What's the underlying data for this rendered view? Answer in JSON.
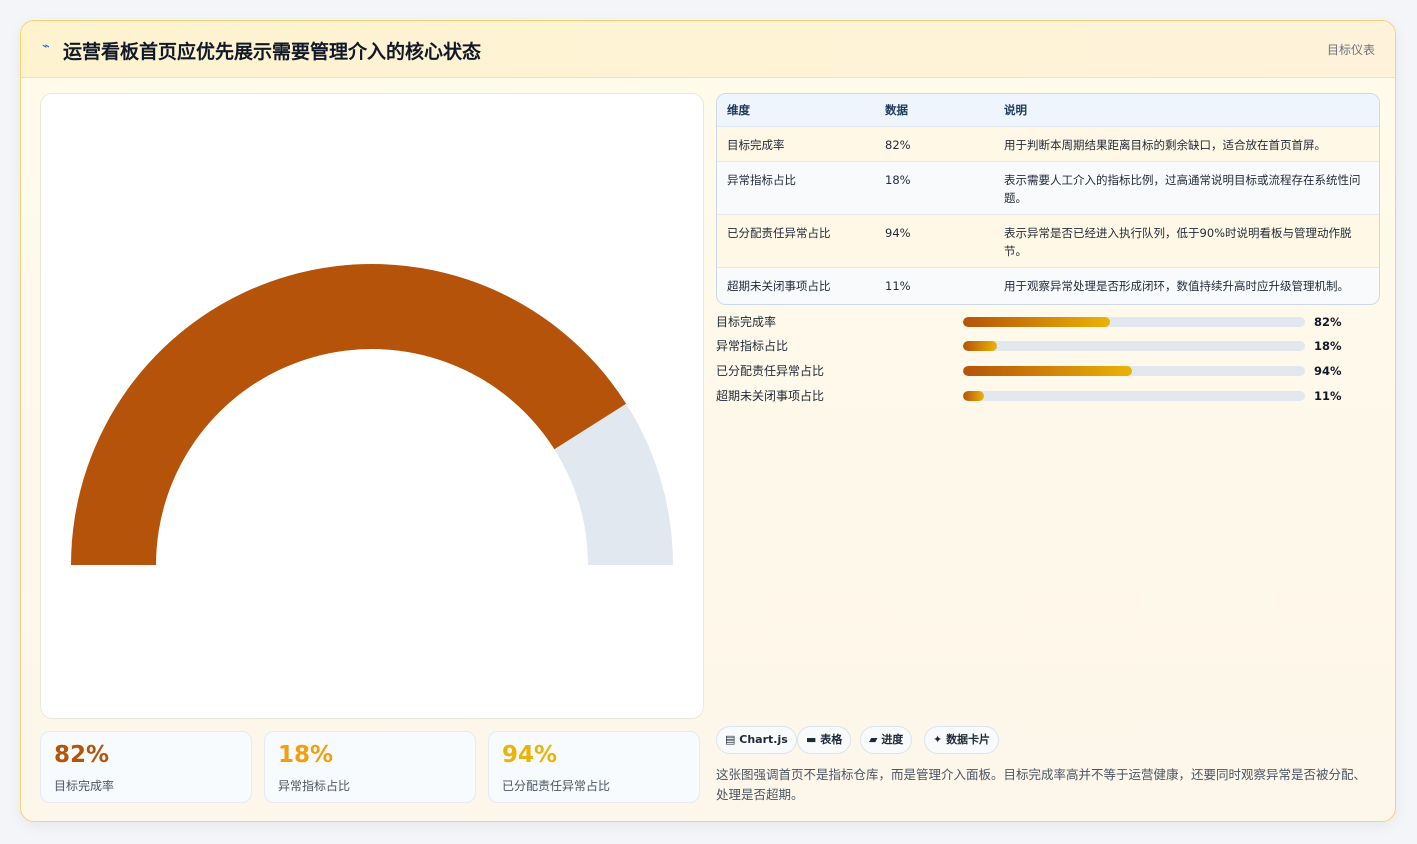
{
  "header": {
    "icon": "lightning-icon",
    "title": "运营看板首页应优先展示需要管理介入的核心状态",
    "right_label": "目标仪表"
  },
  "chart_data": {
    "type": "gauge",
    "value": 82,
    "max": 100,
    "filled_color": "#b45309",
    "track_color": "#e2e8f0"
  },
  "stat_cards": [
    {
      "value": "82%",
      "label": "目标完成率",
      "color": "#b45309"
    },
    {
      "value": "18%",
      "label": "异常指标占比",
      "color": "#f59e0b"
    },
    {
      "value": "94%",
      "label": "已分配责任异常占比",
      "color": "#eab308"
    }
  ],
  "table": {
    "headers": [
      "维度",
      "数据",
      "说明"
    ],
    "rows": [
      {
        "dim": "目标完成率",
        "value": "82%",
        "desc": "用于判断本周期结果距离目标的剩余缺口，适合放在首页首屏。"
      },
      {
        "dim": "异常指标占比",
        "value": "18%",
        "desc": "表示需要人工介入的指标比例，过高通常说明目标或流程存在系统性问题。"
      },
      {
        "dim": "已分配责任异常占比",
        "value": "94%",
        "desc": "表示异常是否已经进入执行队列，低于90%时说明看板与管理动作脱节。"
      },
      {
        "dim": "超期未关闭事项占比",
        "value": "11%",
        "desc": "用于观察异常处理是否形成闭环，数值持续升高时应升级管理机制。"
      }
    ]
  },
  "progress": [
    {
      "label": "目标完成率",
      "percent": 82,
      "fill_fraction": 0.43,
      "value_text": "82%"
    },
    {
      "label": "异常指标占比",
      "percent": 18,
      "fill_fraction": 0.1,
      "value_text": "18%"
    },
    {
      "label": "已分配责任异常占比",
      "percent": 94,
      "fill_fraction": 0.495,
      "value_text": "94%"
    },
    {
      "label": "超期未关闭事项占比",
      "percent": 11,
      "fill_fraction": 0.06,
      "value_text": "11%"
    }
  ],
  "tags": [
    {
      "icon": "chart-icon",
      "glyph": "▤",
      "label": "Chart.js"
    },
    {
      "icon": "table-icon",
      "glyph": "▬",
      "label": "表格"
    },
    {
      "icon": "progress-icon",
      "glyph": "▰",
      "label": "进度"
    },
    {
      "icon": "sparkle-icon",
      "glyph": "✦",
      "label": "数据卡片"
    }
  ],
  "note": "这张图强调首页不是指标仓库，而是管理介入面板。目标完成率高并不等于运营健康，还要同时观察异常是否被分配、处理是否超期。"
}
